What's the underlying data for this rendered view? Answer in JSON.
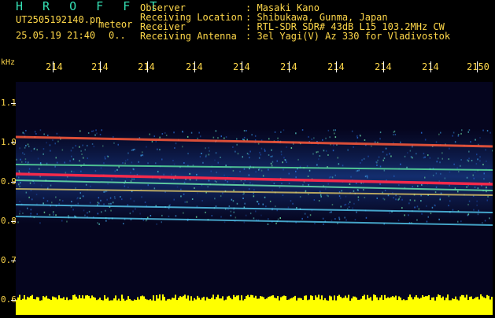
{
  "header": {
    "title": "H R O F F T",
    "filename": "UT2505192140.pn",
    "kind": "meteor",
    "datetime": "25.05.19 21:40",
    "count": "0.."
  },
  "info": [
    {
      "key": "Observer",
      "value": ": Masaki Kano"
    },
    {
      "key": "Receiving Location",
      "value": ": Shibukawa, Gunma, Japan"
    },
    {
      "key": "Receiver",
      "value": ": RTL-SDR SDR# 43dB L15 103.2MHz CW"
    },
    {
      "key": "Receiving Antenna",
      "value": ": 3el Yagi(V) Az 330 for Vladivostok"
    }
  ],
  "axis": {
    "y_unit": "kHz",
    "x_ticks": [
      "214",
      "214",
      "214",
      "214",
      "214",
      "214",
      "214",
      "214",
      "214",
      "2150"
    ],
    "y_ticks": [
      "1.1",
      "1.0",
      "0.9",
      "0.8",
      "0.7",
      "0.6"
    ]
  },
  "colors": {
    "text": "#ffd84a",
    "title": "#35e0b4",
    "background": "#05051e",
    "power_bar": "#ffff00"
  }
}
